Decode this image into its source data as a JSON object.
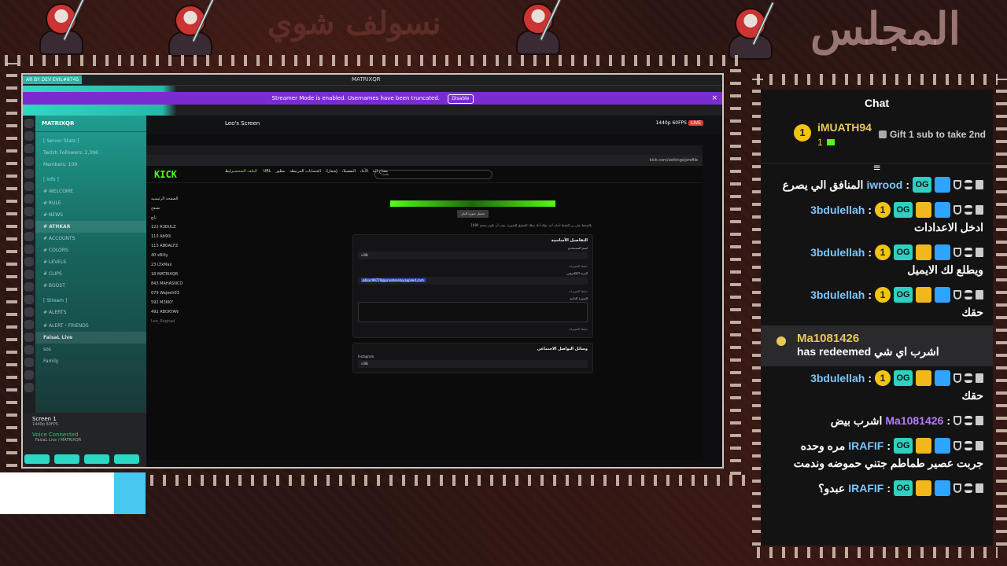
{
  "overlay": {
    "banner_left": "نسولف شوي",
    "banner_right": "المجلس"
  },
  "capture": {
    "discord_brand": "AR BY DEV EVIL#8745",
    "discord_center": "MATRIXQR",
    "streamer_notice": "Streamer Mode is enabled. Usernames have been truncated.",
    "disable_label": "Disable",
    "server_name": "MATRIXQR",
    "channels": [
      {
        "label": "[ Server Stats ]",
        "cat": true
      },
      {
        "label": "Twitch Followers: 2,396",
        "cat": false
      },
      {
        "label": "Members: 109",
        "cat": false
      },
      {
        "label": "[ Info ]",
        "cat": true
      },
      {
        "label": "# WELCOME",
        "cat": false
      },
      {
        "label": "# RULE",
        "cat": false
      },
      {
        "label": "# NEWS",
        "cat": false
      },
      {
        "label": "# ATHKAR",
        "cat": false,
        "active": true
      },
      {
        "label": "# ACCOUNTS",
        "cat": false
      },
      {
        "label": "# COLORS",
        "cat": false
      },
      {
        "label": "# LEVELS",
        "cat": false
      },
      {
        "label": "# CLIPS",
        "cat": false
      },
      {
        "label": "# BOOST",
        "cat": false
      },
      {
        "label": "[ Stream ]",
        "cat": true
      },
      {
        "label": "# ALERTS",
        "cat": false
      },
      {
        "label": "# ALERT・FRIENDS",
        "cat": false
      },
      {
        "label": "FaisaL Live",
        "cat": false,
        "active": true
      },
      {
        "label": "sos",
        "cat": false
      },
      {
        "label": "Family",
        "cat": false
      }
    ],
    "voice_screen": "Screen 1",
    "voice_screen_sub": "1440p 60FPS",
    "voice_connected": "Voice Connected",
    "voice_channel": "FaisaL Live / MATRIXQR",
    "stream_title": "Leo's Screen",
    "stream_quality": "1440p 60FPS",
    "live_badge": "LIVE",
    "browser_url": "kick.com/settings/profile",
    "kick_logo": "KICK",
    "kick_search": "بحث",
    "kick_nav": [
      "الملف الشخصي",
      "رابط URL",
      "مفتاح البث",
      "الأمان",
      "التفضيلات",
      "إشعارات",
      "الحسابات المرتبطة",
      "مطور"
    ],
    "kick_side": [
      {
        "label": "الصفحة الرئيسية",
        "muted": false
      },
      {
        "label": "تصفح",
        "muted": false
      },
      {
        "label": "تابع",
        "muted": false
      },
      {
        "label": "122 R3DULZ",
        "muted": false
      },
      {
        "label": "113 Ab90i",
        "muted": false
      },
      {
        "label": "113 ABOALFZ",
        "muted": false
      },
      {
        "label": "40 xBilly",
        "muted": false
      },
      {
        "label": "23 LTxMax",
        "muted": false
      },
      {
        "label": "18 MATRIXQR",
        "muted": false
      },
      {
        "label": "843 MAHASNCO",
        "muted": false
      },
      {
        "label": "679 Wajeeh03",
        "muted": false
      },
      {
        "label": "592 M3KKY",
        "muted": false
      },
      {
        "label": "492 ABOKYAN",
        "muted": false
      },
      {
        "label": "Leo_Raghad",
        "muted": true
      }
    ],
    "upload_label": "تحميل صورة البانر",
    "form_note": "بالضغط على زر الحفظ أدناه، أنت تؤكد أنك تملك الحقوق للصورة. يجب أن تكون بحجم 1080",
    "basic_title": "التفاصيل الأساسية",
    "username_label": "اسم المستخدم",
    "username_value": "v3l8",
    "email_label": "البريد الإلكتروني",
    "email_value": "p6sxc99779@privaterelay.appleid.com",
    "bio_label": "السيرة الذاتية",
    "social_title": "وسائل التواصل الاجتماعي",
    "instagram_label": "Instagram",
    "instagram_value": "v3l8",
    "save_label": "حفظ التغييرات"
  },
  "chat": {
    "title": "Chat",
    "pinned_user": "iMUATH94",
    "pinned_badge": "1",
    "pinned_count": "1",
    "gift_text": "Gift 1 sub to take 2nd",
    "messages": [
      {
        "user": "iwrood",
        "user_color": "blue",
        "badges": [
          "trash",
          "hour",
          "shield",
          "hammer",
          "og"
        ],
        "text": "المنافق الي يصرع",
        "inline": true
      },
      {
        "user": "3bdulellah",
        "user_color": "blue",
        "badges": [
          "trash",
          "hour",
          "shield",
          "hammer",
          "crown",
          "og",
          "one"
        ],
        "text": "ادخل الاعدادات",
        "inline": false
      },
      {
        "user": "3bdulellah",
        "user_color": "blue",
        "badges": [
          "trash",
          "hour",
          "shield",
          "hammer",
          "crown",
          "og",
          "one"
        ],
        "text": "ويطلع لك الايميل",
        "inline": false
      },
      {
        "user": "3bdulellah",
        "user_color": "blue",
        "badges": [
          "trash",
          "hour",
          "shield",
          "hammer",
          "crown",
          "og",
          "one"
        ],
        "text": "حقك",
        "inline": false
      }
    ],
    "redeem_user": "Ma1081426",
    "redeem_text": "has redeemed",
    "redeem_reward": "اشرب اي شي",
    "messages2": [
      {
        "user": "3bdulellah",
        "user_color": "blue",
        "badges": [
          "trash",
          "hour",
          "shield",
          "hammer",
          "crown",
          "og",
          "one"
        ],
        "text": "حقك",
        "inline": false
      },
      {
        "user": "Ma1081426",
        "user_color": "purple",
        "badges": [
          "trash",
          "hour",
          "shield"
        ],
        "text": "اشرب بيض",
        "inline": true
      },
      {
        "user": "IRAFIF",
        "user_color": "blue",
        "badges": [
          "trash",
          "hour",
          "shield",
          "hammer",
          "crown",
          "og"
        ],
        "text": "مره وحده",
        "extra": "جربت عصير طماطم جتني حموضه وندمت",
        "inline": true
      },
      {
        "user": "IRAFIF",
        "user_color": "blue",
        "badges": [
          "trash",
          "hour",
          "shield",
          "hammer",
          "crown",
          "og"
        ],
        "text": "عبدو؟",
        "inline": true
      }
    ]
  }
}
